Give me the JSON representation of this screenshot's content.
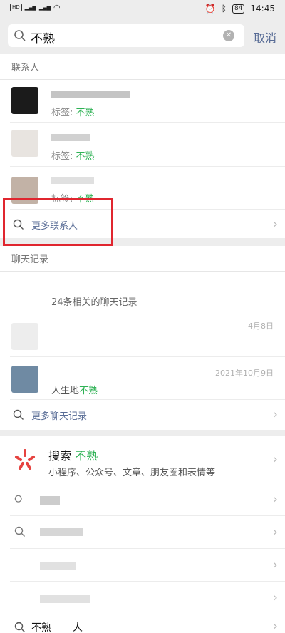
{
  "status": {
    "time": "14:45",
    "battery": "84"
  },
  "search": {
    "query": "不熟",
    "cancel_label": "取消"
  },
  "contacts": {
    "title": "联系人",
    "tag_label": "标签: ",
    "keyword": "不熟",
    "more_label": "更多联系人"
  },
  "chats": {
    "title": "聊天记录",
    "summary": "24条相关的聊天记录",
    "row1_date": "4月8日",
    "row2_date": "2021年10月9日",
    "row2_prefix": "人生地",
    "row2_keyword": "不熟",
    "more_label": "更多聊天记录"
  },
  "websearch": {
    "title_prefix": "搜索 ",
    "title_keyword": "不熟",
    "subtitle": "小程序、公众号、文章、朋友圈和表情等"
  },
  "suggestions": {
    "last_prefix": "不熟",
    "last_suffix": "人"
  },
  "colors": {
    "highlight": "#2fb255",
    "link": "#576b95",
    "annotation": "#e0262f"
  }
}
